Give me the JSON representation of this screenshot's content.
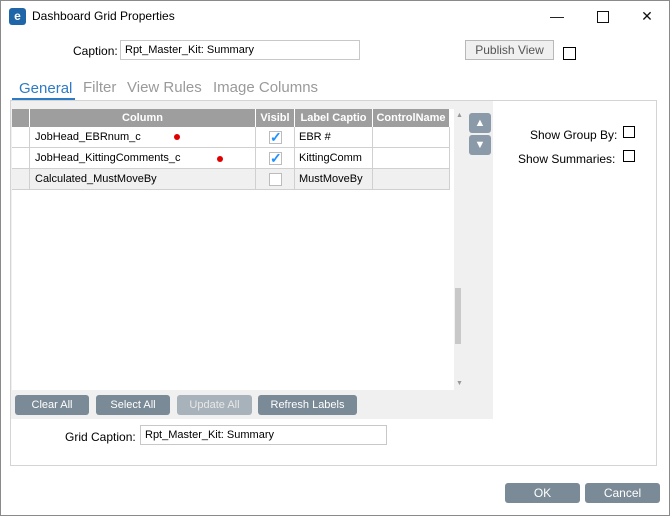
{
  "window": {
    "title": "Dashboard Grid Properties",
    "app_icon_letter": "e",
    "minimize_label": "—",
    "close_label": "✕"
  },
  "caption": {
    "label": "Caption:",
    "value": "Rpt_Master_Kit: Summary",
    "publish_label": "Publish View"
  },
  "tabs": [
    {
      "label": "General",
      "active": true
    },
    {
      "label": "Filter",
      "active": false
    },
    {
      "label": "View Rules",
      "active": false
    },
    {
      "label": "Image Columns",
      "active": false
    }
  ],
  "grid": {
    "headers": [
      "Column",
      "Visibl",
      "Label Captio",
      "ControlName"
    ],
    "rows": [
      {
        "column": "JobHead_EBRnum_c",
        "visible": true,
        "label": "EBR #",
        "control": "",
        "marked": true
      },
      {
        "column": "JobHead_KittingComments_c",
        "visible": true,
        "label": "KittingComm",
        "control": "",
        "marked": true
      },
      {
        "column": "Calculated_MustMoveBy",
        "visible": false,
        "label": "MustMoveBy",
        "control": "",
        "marked": false
      }
    ]
  },
  "move_buttons": {
    "up": "▲",
    "down": "▼"
  },
  "options": {
    "show_group_by": "Show Group By:",
    "show_summaries": "Show Summaries:"
  },
  "actions": {
    "clear_all": "Clear All",
    "select_all": "Select All",
    "update_all": "Update All",
    "refresh_labels": "Refresh Labels"
  },
  "grid_caption": {
    "label": "Grid Caption:",
    "value": "Rpt_Master_Kit: Summary"
  },
  "footer": {
    "ok": "OK",
    "cancel": "Cancel"
  },
  "colors": {
    "accent": "#2d7bc4",
    "header": "#9e9e9e",
    "button": "#7a8a96",
    "marker": "#e00000"
  }
}
